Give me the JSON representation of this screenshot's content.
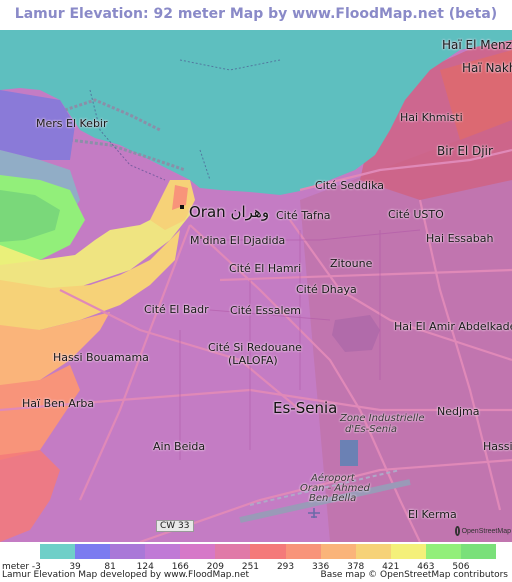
{
  "title": "Lamur Elevation: 92 meter Map by www.FloodMap.net (beta)",
  "places": {
    "hai_el_menzah": "Haï El Menzah",
    "hai_nakhil": "Haï Nakhil",
    "mers_el_kebir": "Mers El Kebir",
    "hai_khmisti": "Hai Khmisti",
    "bir_el_djir": "Bir El Djir",
    "cite_seddika": "Cité Seddika",
    "oran": "Oran",
    "oran_arabic": "وهران",
    "cite_tafna": "Cité Tafna",
    "cite_usto": "Cité USTO",
    "mdina_el_djadida": "M'dina El Djadida",
    "hai_essabah": "Hai Essabah",
    "cite_el_hamri": "Cité El Hamri",
    "zitoune": "Zitoune",
    "cite_dhaya": "Cité Dhaya",
    "cite_el_badr": "Cité El Badr",
    "cite_essalem": "Cité Essalem",
    "hai_el_amir": "Hai El Amir Abdelkader",
    "cite_si_redouane": "Cité Si Redouane",
    "lalofa": "(LALOFA)",
    "hassi_bouamama": "Hassi Bouamama",
    "hai_ben_arba": "Haï Ben Arba",
    "es_senia": "Es-Senia",
    "zone_industrielle": "Zone Industrielle",
    "d_es_senia": "d'Es-Senia",
    "nedjma": "Nedjma",
    "ain_beida": "Ain Beida",
    "hassi": "Hassi",
    "aeroport": "Aéroport",
    "oran_ahmed": "Oran - Ahmed",
    "ben_bella": "Ben Bella",
    "cw33": "CW 33",
    "el_kerma": "El Kerma"
  },
  "legend": {
    "unit_label": "meter -3",
    "ticks": [
      "39",
      "81",
      "124",
      "166",
      "209",
      "251",
      "293",
      "336",
      "378",
      "421",
      "463",
      "506"
    ],
    "colors": [
      "#6fcfc8",
      "#7b7bf0",
      "#a978d8",
      "#c07ad6",
      "#d678c8",
      "#e07aa8",
      "#f47a7a",
      "#f8947a",
      "#fab47a",
      "#f6d278",
      "#f4f07a",
      "#92ef7a",
      "#7ae07a"
    ]
  },
  "footer": {
    "left": "Lamur Elevation Map developed by www.FloodMap.net",
    "right": "Base map © OpenStreetMap contributors"
  },
  "osm_badge": "OpenStreetMap",
  "colors": {
    "sea": "#5ebfbf",
    "low_land": "#c47cc4",
    "title": "#8a8ac8"
  }
}
